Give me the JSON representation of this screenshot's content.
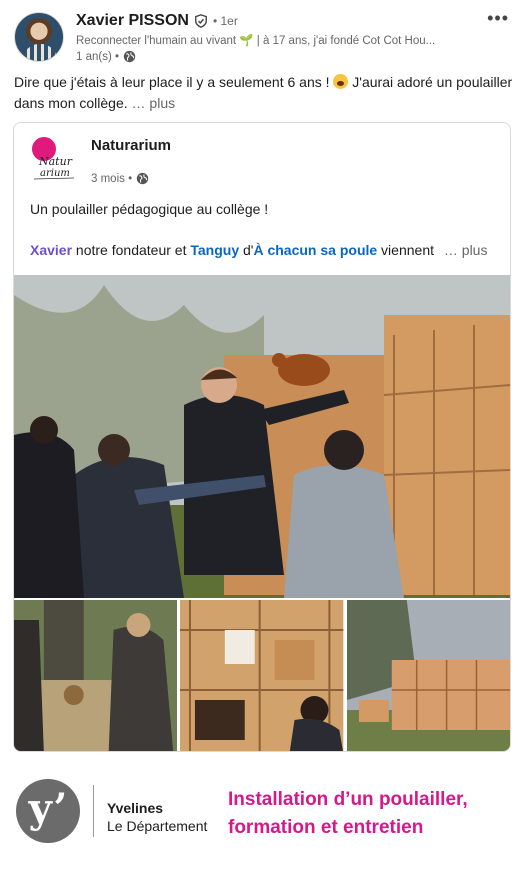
{
  "post": {
    "author_name": "Xavier PISSON",
    "degree": "• 1er",
    "headline": "Reconnecter l'humain au vivant 🌱 | à 17 ans, j'ai fondé Cot Cot Hou...",
    "time": "1 an(s) •",
    "more_label": "•••",
    "text_part1": "Dire que j'étais à leur place il y a seulement 6 ans !",
    "text_part2": "J'aurai adoré un poulailler dans mon collège.",
    "see_more": "… plus"
  },
  "shared": {
    "org_name": "Naturarium",
    "logo_text_line1": "Natur",
    "logo_text_line2": "arium",
    "time": "3 mois •",
    "title_text": "Un poulailler pédagogique au collège !",
    "mention1": "Xavier",
    "text_a": " notre fondateur et ",
    "mention2": "Tanguy",
    "text_b": " d'",
    "mention3": "À chacun sa poule",
    "text_c": " viennent",
    "see_more": "… plus"
  },
  "footer": {
    "logo_letter": "y’",
    "dept_title": "Yvelines",
    "dept_sub": "Le Département",
    "banner_line1": "Installation d’un poulailler,",
    "banner_line2": "formation et entretien"
  },
  "colors": {
    "accent_pink": "#d5188e",
    "mention_purple": "#6b4fd1",
    "mention_blue": "#0a66c2"
  }
}
